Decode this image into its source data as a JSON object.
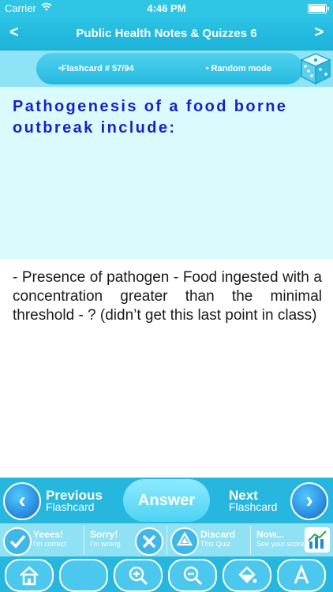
{
  "status": {
    "carrier": "Carrier",
    "time": "4:46 PM"
  },
  "nav": {
    "title": "Public Health Notes & Quizzes 6",
    "back": "<",
    "forward": ">"
  },
  "mode": {
    "flashcard": "•Flashcard #  57/94",
    "random": "• Random mode"
  },
  "card": {
    "question": "Pathogenesis of a food borne outbreak include:",
    "answer": "- Presence of pathogen - Food ingested with a concentration greater than the minimal threshold - ? (didn’t get this last point in class)"
  },
  "controls": {
    "previous": "Previous",
    "previous_sub": "Flashcard",
    "answer": "Answer",
    "next": "Next",
    "next_sub": "Flashcard",
    "yes": "Yeees!",
    "yes_sub": "I'm correct",
    "sorry": "Sorry!",
    "sorry_sub": "I'm wrong",
    "discard": "Discard",
    "discard_sub": "This Quiz",
    "now": "Now...",
    "now_sub": "See your score"
  },
  "icons": [
    "home-icon",
    "blank-circle-icon",
    "zoom-in-icon",
    "zoom-out-icon",
    "paint-bucket-icon",
    "text-size-icon"
  ],
  "colors": {
    "accent": "#27b6dd",
    "question_text": "#1a1fc9",
    "question_bg": "#d9fbfd"
  }
}
